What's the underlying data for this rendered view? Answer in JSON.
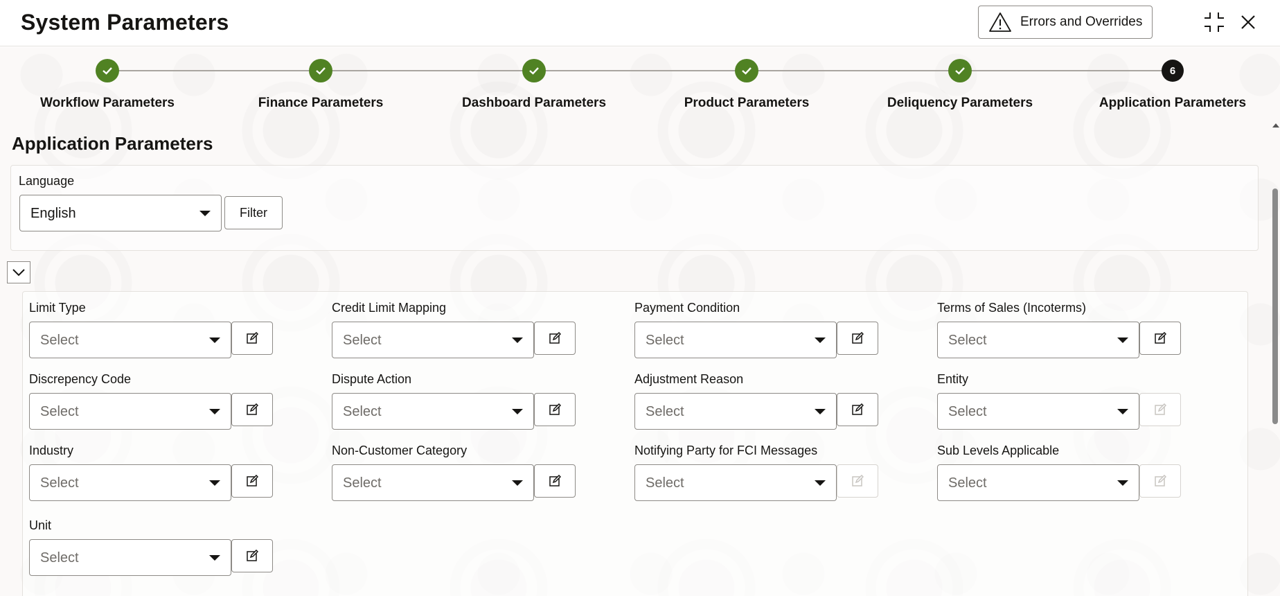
{
  "header": {
    "title": "System Parameters",
    "errors_button": "Errors and Overrides",
    "icons": [
      "warning-icon",
      "collapse-window-icon",
      "close-icon"
    ]
  },
  "train": {
    "steps": [
      {
        "label": "Workflow Parameters",
        "status": "completed"
      },
      {
        "label": "Finance Parameters",
        "status": "completed"
      },
      {
        "label": "Dashboard Parameters",
        "status": "completed"
      },
      {
        "label": "Product Parameters",
        "status": "completed"
      },
      {
        "label": "Deliquency Parameters",
        "status": "completed"
      },
      {
        "label": "Application Parameters",
        "status": "current",
        "number": "6"
      }
    ],
    "colors": {
      "completed": "#508223",
      "current": "#161513"
    }
  },
  "section": {
    "title": "Application Parameters"
  },
  "language": {
    "label": "Language",
    "value": "English",
    "filter_label": "Filter"
  },
  "fields": [
    {
      "label": "Limit Type",
      "value": "Select",
      "edit_enabled": true
    },
    {
      "label": "Credit Limit Mapping",
      "value": "Select",
      "edit_enabled": true
    },
    {
      "label": "Payment Condition",
      "value": "Select",
      "edit_enabled": true
    },
    {
      "label": "Terms of Sales (Incoterms)",
      "value": "Select",
      "edit_enabled": true
    },
    {
      "label": "Discrepency Code",
      "value": "Select",
      "edit_enabled": true
    },
    {
      "label": "Dispute Action",
      "value": "Select",
      "edit_enabled": true
    },
    {
      "label": "Adjustment Reason",
      "value": "Select",
      "edit_enabled": true
    },
    {
      "label": "Entity",
      "value": "Select",
      "edit_enabled": false
    },
    {
      "label": "Industry",
      "value": "Select",
      "edit_enabled": true
    },
    {
      "label": "Non-Customer Category",
      "value": "Select",
      "edit_enabled": true
    },
    {
      "label": "Notifying Party for FCI Messages",
      "value": "Select",
      "edit_enabled": false
    },
    {
      "label": "Sub Levels Applicable",
      "value": "Select",
      "edit_enabled": false
    },
    {
      "label": "Unit",
      "value": "Select",
      "edit_enabled": true
    }
  ]
}
